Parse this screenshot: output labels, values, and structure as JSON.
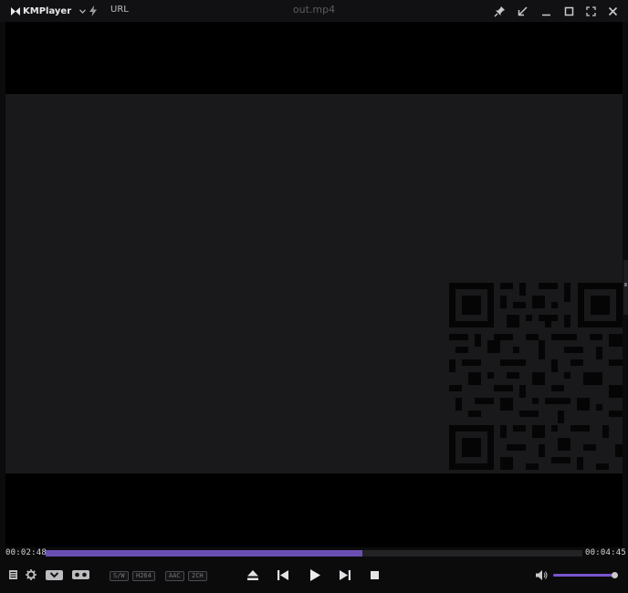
{
  "app": {
    "name": "KMPlayer",
    "url_label": "URL",
    "file_title": "out.mp4"
  },
  "playback": {
    "current_time": "00:02:48",
    "total_time": "00:04:45",
    "progress": 0.59,
    "volume": 1.0
  },
  "codec_badges": [
    "S/W",
    "H264",
    "AAC",
    "2CH"
  ],
  "colors": {
    "accent": "#6a4fb3",
    "volume_accent": "#7a55d0",
    "background": "#0b0b0c",
    "frame": "#19191b"
  },
  "icons": {
    "logo": "kmplayer-logo-icon",
    "menu": "chevron-down-icon",
    "bolt": "lightning-icon",
    "pin": "pin-icon",
    "minimize_to_corner": "arrow-down-left-icon",
    "minimize": "minimize-icon",
    "maximize": "maximize-icon",
    "fullscreen": "fullscreen-icon",
    "close": "close-icon",
    "playlist": "playlist-icon",
    "settings": "gear-icon",
    "capture": "capture-icon",
    "vr": "vr-goggles-icon",
    "eject": "eject-icon",
    "previous": "skip-previous-icon",
    "play": "play-icon",
    "next": "skip-next-icon",
    "stop": "stop-icon",
    "volume": "speaker-icon"
  }
}
